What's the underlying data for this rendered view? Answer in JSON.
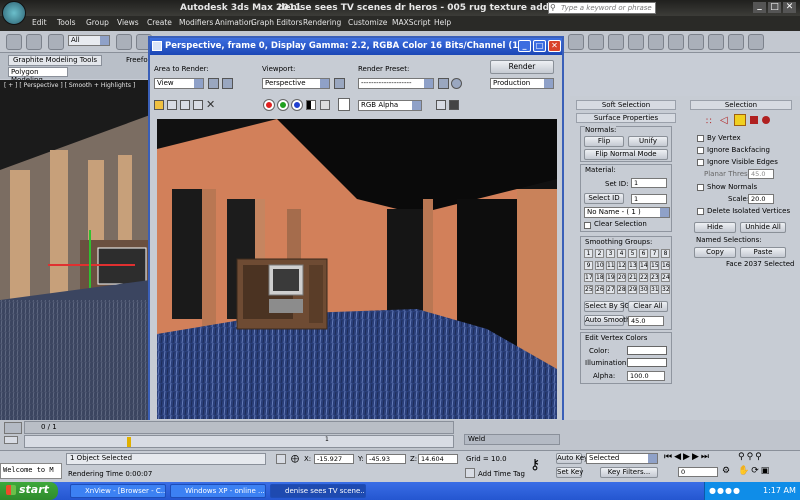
{
  "app": {
    "title_app": "Autodesk 3ds Max  2011",
    "title_file": "denise sees TV scenes dr heros - 005 rug texture added.max",
    "search_placeholder": "Type a keyword or phrase"
  },
  "menu": [
    "Edit",
    "Tools",
    "Group",
    "Views",
    "Create",
    "Modifiers",
    "Animation",
    "Graph Editors",
    "Rendering",
    "Customize",
    "MAXScript",
    "Help"
  ],
  "toolbar": {
    "selection_filter": "All"
  },
  "ribbon": {
    "tab_graphite": "Graphite Modeling Tools",
    "tab_freeform": "Freeform",
    "sub": "Polygon Modeling"
  },
  "viewport": {
    "label": "[ + ] [ Perspective ] [ Smooth + Highlights ]"
  },
  "render_frame": {
    "title": "Perspective, frame 0, Display Gamma: 2.2, RGBA Color 16 Bits/Channel (1:1)",
    "area_label": "Area to Render:",
    "area_value": "View",
    "viewport_label": "Viewport:",
    "viewport_value": "Perspective",
    "preset_label": "Render Preset:",
    "preset_value": "--------------------",
    "render_button": "Render",
    "mode_value": "Production",
    "channel_value": "RGB Alpha"
  },
  "modify_panel": {
    "soft_selection": "Soft Selection",
    "surface_properties": "Surface Properties",
    "normals_label": "Normals:",
    "flip": "Flip",
    "unify": "Unify",
    "flip_normal_mode": "Flip Normal Mode",
    "material_label": "Material:",
    "set_id_label": "Set ID:",
    "set_id_value": "1",
    "select_id_button": "Select ID",
    "select_id_value": "1",
    "material_name": "No Name - ( 1 )",
    "clear_selection": "Clear Selection",
    "smoothing_label": "Smoothing Groups:",
    "smoothing_groups": [
      "1",
      "2",
      "3",
      "4",
      "5",
      "6",
      "7",
      "8",
      "9",
      "10",
      "11",
      "12",
      "13",
      "14",
      "15",
      "16",
      "17",
      "18",
      "19",
      "20",
      "21",
      "22",
      "23",
      "24",
      "25",
      "26",
      "27",
      "28",
      "29",
      "30",
      "31",
      "32"
    ],
    "select_by_sg": "Select By SG",
    "clear_all": "Clear All",
    "auto_smooth": "Auto Smooth",
    "auto_smooth_value": "45.0",
    "edit_vertex_colors": "Edit Vertex Colors",
    "color_label": "Color:",
    "illumination_label": "Illumination:",
    "alpha_label": "Alpha:",
    "alpha_value": "100.0"
  },
  "selection_panel": {
    "title": "Selection",
    "by_vertex": "By Vertex",
    "ignore_backfacing": "Ignore Backfacing",
    "ignore_visible_edges": "Ignore Visible Edges",
    "planar_thresh_label": "Planar Thresh:",
    "planar_thresh_value": "45.0",
    "show_normals": "Show Normals",
    "scale_label": "Scale:",
    "scale_value": "20.0",
    "delete_isolated": "Delete Isolated Vertices",
    "hide": "Hide",
    "unhide_all": "Unhide All",
    "named_selections": "Named Selections:",
    "copy": "Copy",
    "paste": "Paste",
    "face_status": "Face 2037 Selected",
    "weld": "Weld"
  },
  "timeline": {
    "frame_counter": "0 / 1",
    "tick_mark": "1"
  },
  "status": {
    "listener": "Welcome to M",
    "objects_selected": "1 Object Selected",
    "rendering_time": "Rendering Time  0:00:07",
    "x_value": "-15.927",
    "y_value": "-45.93",
    "z_value": "14.604",
    "grid": "Grid = 10.0",
    "add_time_tag": "Add Time Tag",
    "auto_key": "Auto Key",
    "set_key": "Set Key",
    "selected_value": "Selected",
    "key_filters": "Key Filters...",
    "frame_field": "0"
  },
  "taskbar": {
    "start": "start",
    "tasks": [
      "XnView - [Browser - C...",
      "Windows XP - online ...",
      "denise sees TV scene..."
    ],
    "clock": "1:17 AM"
  },
  "colors": {
    "title_bg": "#2a2a27",
    "render_title": "#1b46b5",
    "taskbar": "#2456d0",
    "start_green": "#2e8b2c",
    "wall_orange": "#d07a52",
    "ceiling": "#111111",
    "floor_blue": "#2a3f7a"
  }
}
